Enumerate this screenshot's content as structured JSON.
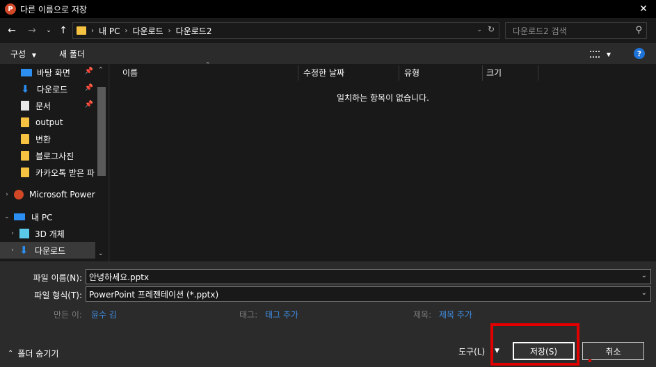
{
  "window": {
    "title": "다른 이름으로 저장",
    "app_icon_letter": "P",
    "close_glyph": "✕"
  },
  "address": {
    "crumbs": [
      "내 PC",
      "다운로드",
      "다운로드2"
    ],
    "search_placeholder": "다운로드2 검색"
  },
  "toolbar": {
    "organize_label": "구성",
    "new_folder_label": "새 폴더",
    "help_label": "?"
  },
  "nav": {
    "items": [
      {
        "label": "바탕 화면",
        "icon": "desktop-icon"
      },
      {
        "label": "다운로드",
        "icon": "download-icon"
      },
      {
        "label": "문서",
        "icon": "document-icon"
      },
      {
        "label": "output",
        "icon": "folder-icon"
      },
      {
        "label": "변환",
        "icon": "folder-icon"
      },
      {
        "label": "블로그사진",
        "icon": "folder-icon"
      },
      {
        "label": "카카오톡 받은 파",
        "icon": "folder-icon"
      },
      {
        "label": "Microsoft PowerP",
        "icon": "powerpoint-icon"
      },
      {
        "label": "내 PC",
        "icon": "pc-icon"
      },
      {
        "label": "3D 개체",
        "icon": "3d-objects-icon"
      },
      {
        "label": "다운로드",
        "icon": "download-icon"
      }
    ]
  },
  "filelist": {
    "columns": [
      "이름",
      "수정한 날짜",
      "유형",
      "크기"
    ],
    "empty_message": "일치하는 항목이 없습니다."
  },
  "form": {
    "filename_label": "파일 이름(N):",
    "filename_value": "안녕하세요.pptx",
    "filetype_label": "파일 형식(T):",
    "filetype_value": "PowerPoint 프레젠테이션 (*.pptx)",
    "author_label": "만든 이:",
    "author_value": "윤수 김",
    "tags_label": "태그:",
    "tags_value": "태그 추가",
    "title_label": "제목:",
    "title_value": "제목 추가"
  },
  "footer": {
    "hide_folders_label": "폴더 숨기기",
    "tools_label": "도구(L)",
    "save_label": "저장(S)",
    "cancel_label": "취소"
  },
  "colors": {
    "accent_link": "#3f8fe6",
    "highlight_red": "#e00000",
    "folder_yellow": "#f5c242",
    "help_blue": "#1e73d8"
  }
}
